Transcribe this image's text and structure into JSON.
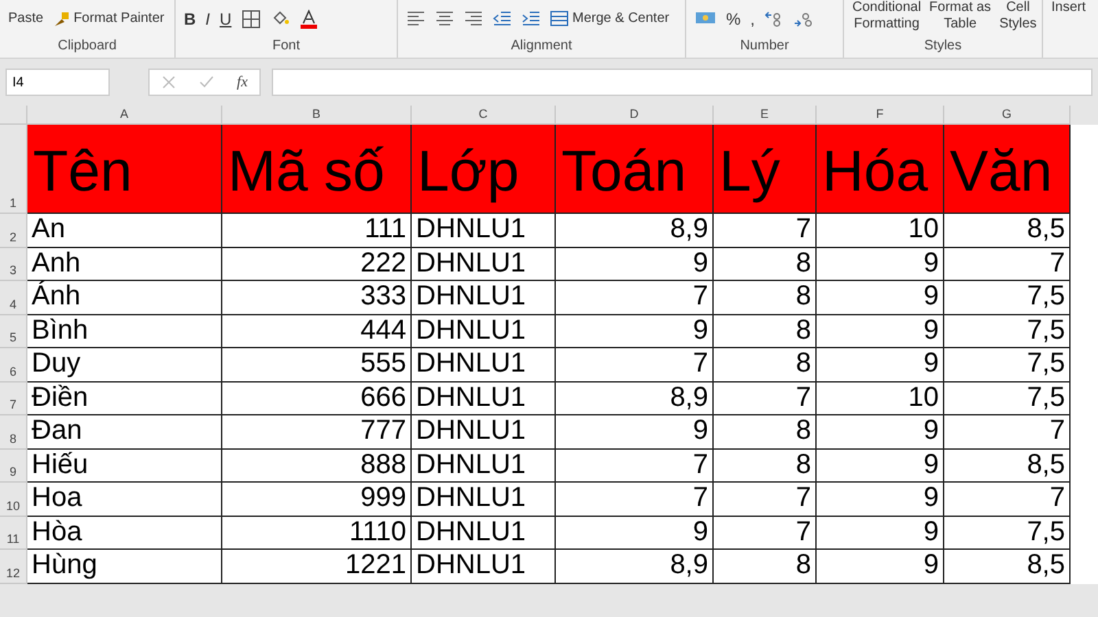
{
  "ribbon": {
    "paste": "Paste",
    "format_painter": "Format Painter",
    "merge": "Merge & Center",
    "percent": "%",
    "comma": ",",
    "conditional": [
      "Conditional",
      "Formatting"
    ],
    "format_table": [
      "Format as",
      "Table"
    ],
    "cell_styles": [
      "Cell",
      "Styles"
    ],
    "insert": "Insert",
    "bold": "B",
    "italic": "I",
    "underline": "U",
    "groups": [
      "Clipboard",
      "Font",
      "Alignment",
      "Number",
      "Styles"
    ]
  },
  "formula_bar": {
    "name_box": "I4",
    "fx": "fx"
  },
  "columns": [
    {
      "letter": "A",
      "kind": "text"
    },
    {
      "letter": "B",
      "kind": "number"
    },
    {
      "letter": "C",
      "kind": "text"
    },
    {
      "letter": "D",
      "kind": "number"
    },
    {
      "letter": "E",
      "kind": "number"
    },
    {
      "letter": "F",
      "kind": "number"
    },
    {
      "letter": "G",
      "kind": "number"
    }
  ],
  "header_row": {
    "number": "1",
    "color": "#ff0000",
    "cells": [
      "Tên",
      "Mã số",
      "Lớp",
      "Toán",
      "Lý",
      "Hóa",
      "Văn"
    ]
  },
  "rows": [
    {
      "number": "2",
      "cells": [
        "An",
        "111",
        "DHNLU1",
        "8,9",
        "7",
        "10",
        "8,5"
      ]
    },
    {
      "number": "3",
      "cells": [
        "Anh",
        "222",
        "DHNLU1",
        "9",
        "8",
        "9",
        "7"
      ]
    },
    {
      "number": "4",
      "cells": [
        "Ánh",
        "333",
        "DHNLU1",
        "7",
        "8",
        "9",
        "7,5"
      ]
    },
    {
      "number": "5",
      "cells": [
        "Bình",
        "444",
        "DHNLU1",
        "9",
        "8",
        "9",
        "7,5"
      ]
    },
    {
      "number": "6",
      "cells": [
        "Duy",
        "555",
        "DHNLU1",
        "7",
        "8",
        "9",
        "7,5"
      ]
    },
    {
      "number": "7",
      "cells": [
        "Điền",
        "666",
        "DHNLU1",
        "8,9",
        "7",
        "10",
        "7,5"
      ]
    },
    {
      "number": "8",
      "cells": [
        "Đan",
        "777",
        "DHNLU1",
        "9",
        "8",
        "9",
        "7"
      ]
    },
    {
      "number": "9",
      "cells": [
        "Hiếu",
        "888",
        "DHNLU1",
        "7",
        "8",
        "9",
        "8,5"
      ]
    },
    {
      "number": "10",
      "cells": [
        "Hoa",
        "999",
        "DHNLU1",
        "7",
        "7",
        "9",
        "7"
      ]
    },
    {
      "number": "11",
      "cells": [
        "Hòa",
        "1110",
        "DHNLU1",
        "9",
        "7",
        "9",
        "7,5"
      ]
    },
    {
      "number": "12",
      "cells": [
        "Hùng",
        "1221",
        "DHNLU1",
        "8,9",
        "8",
        "9",
        "8,5"
      ]
    }
  ]
}
